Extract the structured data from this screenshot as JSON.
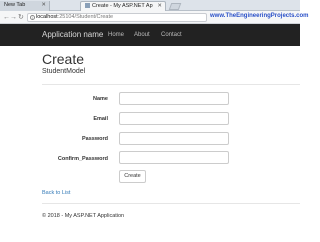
{
  "browser": {
    "tabs": [
      {
        "title": "New Tab"
      },
      {
        "title": "Create - My ASP.NET Ap"
      }
    ],
    "url_host": "localhost",
    "url_path": ":25104/Student/Create",
    "watermark": "www.TheEngineeringProjects.com"
  },
  "navbar": {
    "brand": "Application name",
    "links": [
      "Home",
      "About",
      "Contact"
    ]
  },
  "page": {
    "title": "Create",
    "subtitle": "StudentModel"
  },
  "form": {
    "fields": [
      {
        "label": "Name",
        "value": ""
      },
      {
        "label": "Email",
        "value": ""
      },
      {
        "label": "Password",
        "value": ""
      },
      {
        "label": "Confirm_Password",
        "value": ""
      }
    ],
    "submit_label": "Create"
  },
  "back_link": "Back to List",
  "footer": "© 2018 - My ASP.NET Application"
}
